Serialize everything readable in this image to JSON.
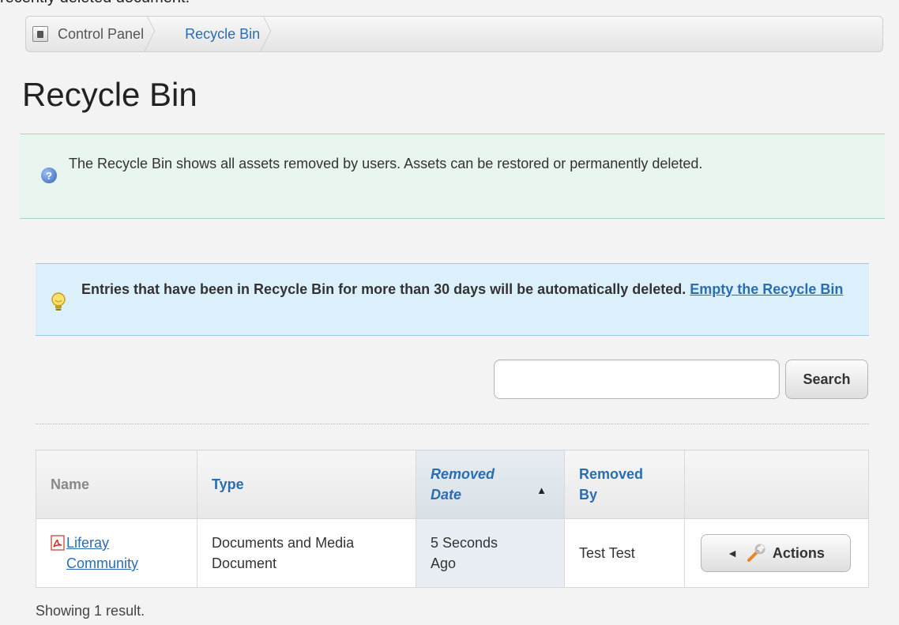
{
  "caption": "recently deleted document.",
  "breadcrumb": {
    "items": [
      {
        "label": "Control Panel"
      },
      {
        "label": "Recycle Bin"
      }
    ]
  },
  "page_title": "Recycle Bin",
  "info_message": "The Recycle Bin shows all assets removed by users. Assets can be restored or permanently deleted.",
  "tip": {
    "text": "Entries that have been in Recycle Bin for more than 30 days will be automatically deleted.",
    "link_label": "Empty the Recycle Bin"
  },
  "search": {
    "value": "",
    "placeholder": "",
    "button_label": "Search"
  },
  "table": {
    "headers": {
      "name": "Name",
      "type": "Type",
      "removed_date": "Removed Date",
      "removed_by": "Removed By"
    },
    "rows": [
      {
        "name": "Liferay Community",
        "type": "Documents and Media Document",
        "removed_date": "5 Seconds Ago",
        "removed_by": "Test Test",
        "action_label": "Actions"
      }
    ]
  },
  "result_count": "Showing 1 result.",
  "colors": {
    "link": "#2a6db1",
    "info_bg": "#e8f4ee",
    "tip_bg": "#dcf0fc"
  },
  "icons": [
    "home-icon",
    "info-icon",
    "lightbulb-icon",
    "sort-ascending-icon",
    "pdf-icon",
    "wrench-icon"
  ]
}
